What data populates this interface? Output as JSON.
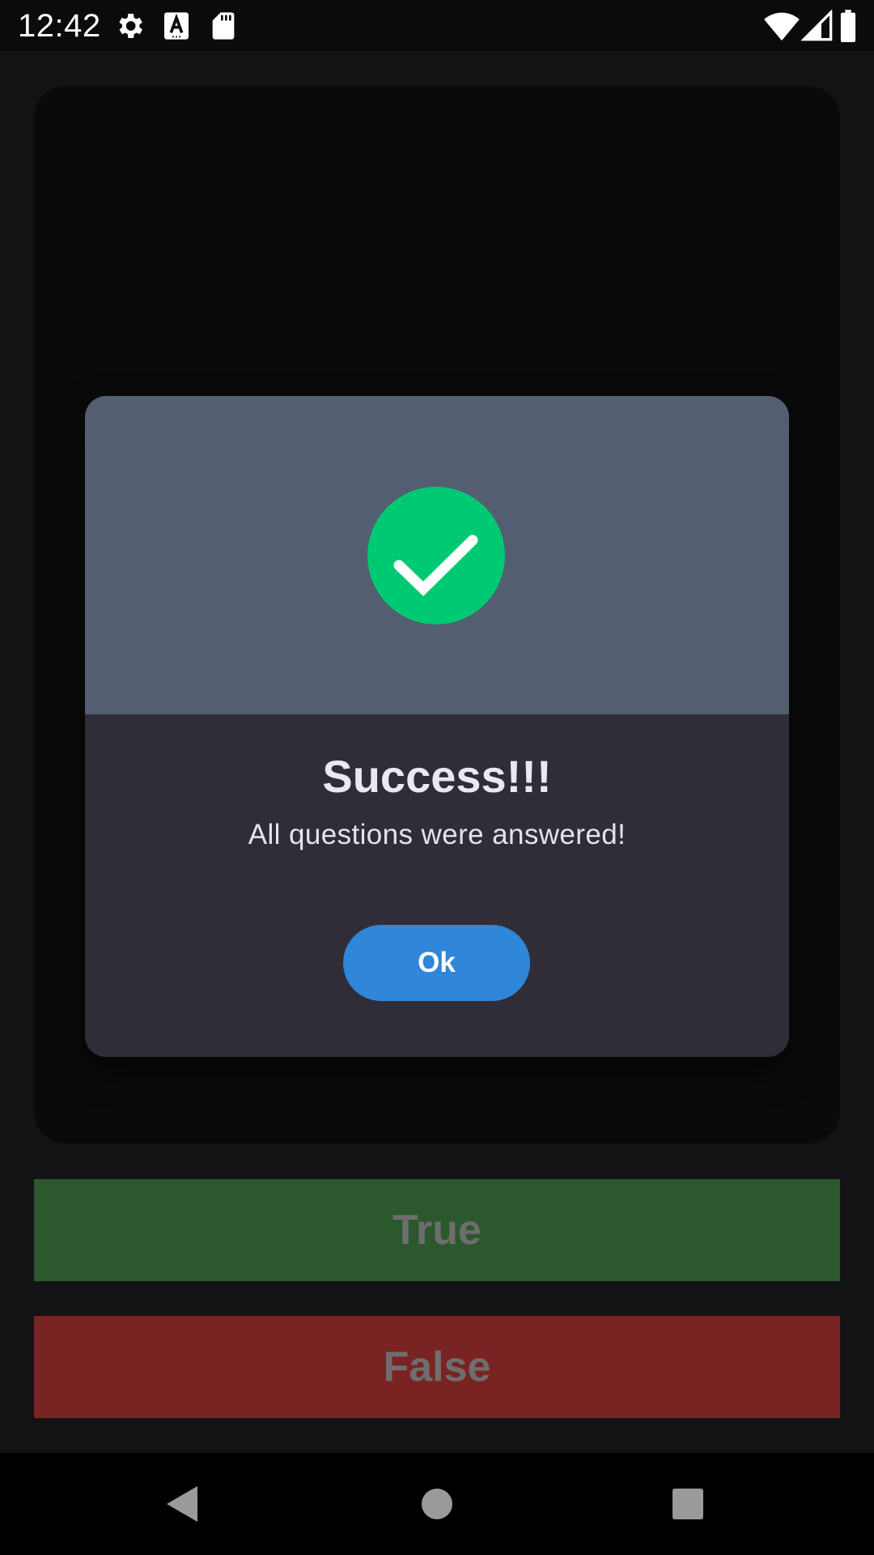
{
  "status_bar": {
    "time": "12:42",
    "icons": [
      "gear-icon",
      "font-a-icon",
      "sd-card-icon",
      "wifi-icon",
      "signal-icon",
      "battery-icon"
    ]
  },
  "answers": {
    "true_label": "True",
    "false_label": "False",
    "true_color": "#2b582d",
    "false_color": "#7a2323"
  },
  "dialog": {
    "icon": "check-circle-icon",
    "icon_color": "#00c973",
    "title": "Success!!!",
    "message": "All questions were answered!",
    "ok_label": "Ok",
    "ok_color": "#3086d9"
  },
  "nav_bar": {
    "icons": [
      "back-icon",
      "home-icon",
      "recents-icon"
    ]
  }
}
